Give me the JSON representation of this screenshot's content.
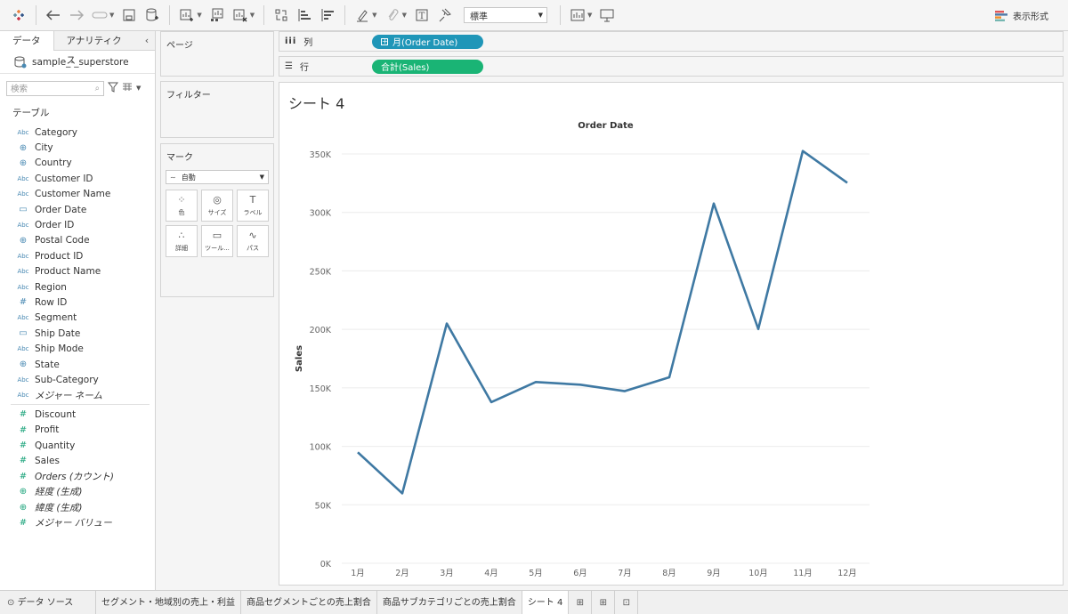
{
  "toolbar": {
    "format_select": "標準",
    "show_me": "表示形式"
  },
  "left": {
    "tabs": [
      "データ",
      "アナリティクス"
    ],
    "datasource": "sample_-_superstore",
    "search_placeholder": "検索",
    "section": "テーブル",
    "dimensions": [
      {
        "icon": "Abc",
        "name": "Category"
      },
      {
        "icon": "globe",
        "name": "City"
      },
      {
        "icon": "globe",
        "name": "Country"
      },
      {
        "icon": "Abc",
        "name": "Customer ID"
      },
      {
        "icon": "Abc",
        "name": "Customer Name"
      },
      {
        "icon": "calendar",
        "name": "Order Date"
      },
      {
        "icon": "Abc",
        "name": "Order ID"
      },
      {
        "icon": "globe",
        "name": "Postal Code"
      },
      {
        "icon": "Abc",
        "name": "Product ID"
      },
      {
        "icon": "Abc",
        "name": "Product Name"
      },
      {
        "icon": "Abc",
        "name": "Region"
      },
      {
        "icon": "#",
        "name": "Row ID"
      },
      {
        "icon": "Abc",
        "name": "Segment"
      },
      {
        "icon": "calendar",
        "name": "Ship Date"
      },
      {
        "icon": "Abc",
        "name": "Ship Mode"
      },
      {
        "icon": "globe",
        "name": "State"
      },
      {
        "icon": "Abc",
        "name": "Sub-Category"
      },
      {
        "icon": "Abc",
        "name": "メジャー ネーム",
        "italic": true
      }
    ],
    "measures": [
      {
        "icon": "#",
        "name": "Discount"
      },
      {
        "icon": "#",
        "name": "Profit"
      },
      {
        "icon": "#",
        "name": "Quantity"
      },
      {
        "icon": "#",
        "name": "Sales"
      },
      {
        "icon": "#",
        "name": "Orders (カウント)",
        "italic": true
      },
      {
        "icon": "globe",
        "name": "経度 (生成)",
        "italic": true
      },
      {
        "icon": "globe",
        "name": "緯度 (生成)",
        "italic": true
      },
      {
        "icon": "#",
        "name": "メジャー バリュー",
        "italic": true
      }
    ]
  },
  "cards": {
    "pages": "ページ",
    "filters": "フィルター",
    "marks": "マーク",
    "mark_type": "自動",
    "mark_buttons": [
      {
        "icon": "color-icon",
        "glyph": "⁘",
        "label": "色"
      },
      {
        "icon": "size-icon",
        "glyph": "◎",
        "label": "サイズ"
      },
      {
        "icon": "label-icon",
        "glyph": "T",
        "label": "ラベル"
      },
      {
        "icon": "detail-icon",
        "glyph": "∴",
        "label": "詳細"
      },
      {
        "icon": "tooltip-icon",
        "glyph": "▭",
        "label": "ツール..."
      },
      {
        "icon": "path-icon",
        "glyph": "∿",
        "label": "パス"
      }
    ]
  },
  "shelves": {
    "columns_label": "列",
    "columns_pill": "月(Order Date)",
    "rows_label": "行",
    "rows_pill": "合計(Sales)"
  },
  "view": {
    "sheet_title": "シート 4"
  },
  "chart_data": {
    "type": "line",
    "title": "Order Date",
    "xlabel": "",
    "ylabel": "Sales",
    "categories": [
      "1月",
      "2月",
      "3月",
      "4月",
      "5月",
      "6月",
      "7月",
      "8月",
      "9月",
      "10月",
      "11月",
      "12月"
    ],
    "values": [
      94900,
      59800,
      205000,
      137800,
      155000,
      152700,
      147200,
      159000,
      307600,
      200300,
      352500,
      325300
    ],
    "ylim": [
      0,
      350000
    ],
    "yticks": [
      0,
      50000,
      100000,
      150000,
      200000,
      250000,
      300000,
      350000
    ],
    "ytick_labels": [
      "0K",
      "50K",
      "100K",
      "150K",
      "200K",
      "250K",
      "300K",
      "350K"
    ],
    "grid": true,
    "line_color": "#3f79a3"
  },
  "bottom_tabs": {
    "datasource": "データ ソース",
    "sheets": [
      "セグメント・地域別の売上・利益",
      "商品セグメントごとの売上割合",
      "商品サブカテゴリごとの売上割合",
      "シート 4"
    ]
  }
}
